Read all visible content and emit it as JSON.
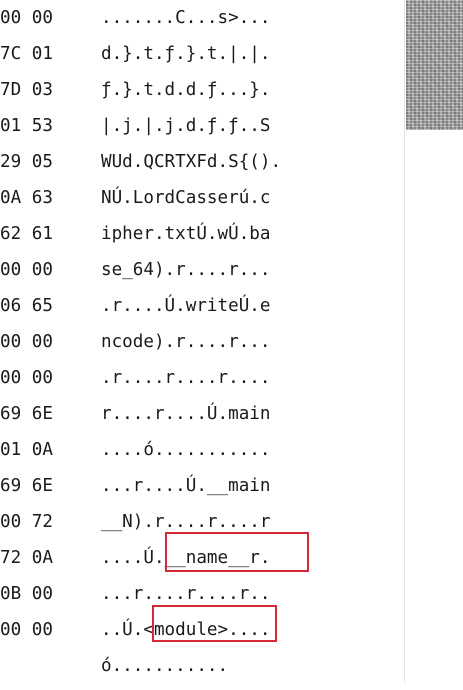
{
  "hex_rows": [
    "00 00",
    "7C 01",
    "7D 03",
    "01 53",
    "29 05",
    "0A 63",
    "62 61",
    "00 00",
    "06 65",
    "00 00",
    "00 00",
    "69 6E",
    "01 0A",
    "69 6E",
    "00 72",
    "72 0A",
    "0B 00",
    "00 00"
  ],
  "ascii_rows": [
    ".......C...s>...",
    "d.}.t.ƒ.}.t.|.|.",
    "ƒ.}.t.d.d.ƒ...}.",
    "|.j.|.j.d.ƒ.ƒ..S",
    "WUd.QCRTXFd.S{().",
    "NÚ.LordCasserú.c",
    "ipher.txtÚ.wÚ.ba",
    "se_64).r....r...",
    ".r....Ú.writeÚ.e",
    "ncode).r....r...",
    ".r....r....r....",
    "r....r....Ú.main",
    "....ó...........",
    "...r....Ú.__main",
    "__N).r....r....r",
    "....Ú.__name__r.",
    "...r....r....r..",
    "..Ú.<module>....",
    "ó..........."
  ],
  "highlights": [
    {
      "name": "highlight-name",
      "text": "__name__r"
    },
    {
      "name": "highlight-module",
      "text": "<module>"
    }
  ],
  "colors": {
    "highlight_border": "#d42a35",
    "text": "#1a1a1a",
    "minimap_thumb": "#9a9a9a"
  }
}
